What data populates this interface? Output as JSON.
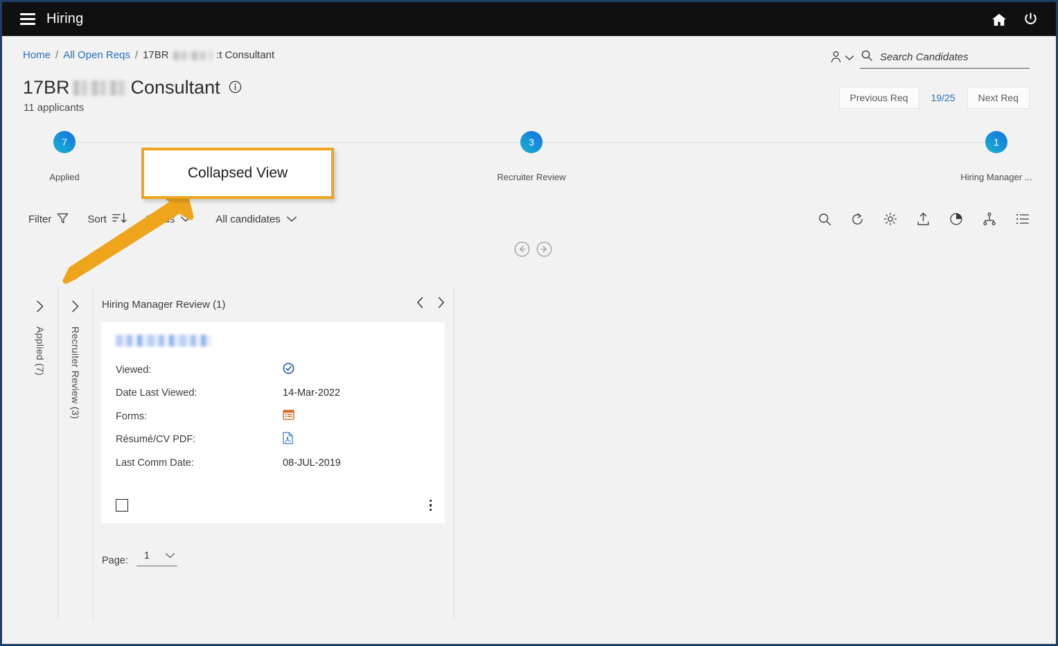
{
  "topbar": {
    "menu_icon": "hamburger-icon",
    "app_title": "Hiring",
    "home_icon": "home-icon",
    "power_icon": "power-icon"
  },
  "breadcrumb": {
    "items": [
      {
        "label": "Home",
        "link": true
      },
      {
        "label": "All Open Reqs",
        "link": true
      },
      {
        "label": "17BR",
        "link": false,
        "redacted_after": true,
        "suffix": ":t Consultant"
      }
    ],
    "separator": "/"
  },
  "header": {
    "title_prefix": "17BR",
    "title_suffix": "Consultant",
    "info_icon": "info-icon",
    "applicants": "11 applicants"
  },
  "search": {
    "person_icon": "person-icon",
    "chevron_icon": "chevron-down-icon",
    "search_icon": "search-icon",
    "placeholder": "Search Candidates",
    "value": ""
  },
  "req_pager": {
    "previous_label": "Previous Req",
    "count": "19/25",
    "next_label": "Next Req"
  },
  "pipeline": {
    "stages": [
      {
        "count": "7",
        "label": "Applied",
        "left_pct": 0
      },
      {
        "count": "3",
        "label": "Recruiter Review",
        "left_pct": 50
      },
      {
        "count": "1",
        "label": "Hiring Manager ...",
        "left_pct": 100
      }
    ]
  },
  "filterbar": {
    "filter_label": "Filter",
    "filter_icon": "funnel-icon",
    "sort_label": "Sort",
    "sort_icon": "sort-descending-icon",
    "status_label": "Status",
    "status_icon": "chevron-down-icon",
    "candidates_label": "All candidates",
    "candidates_icon": "chevron-down-icon"
  },
  "iconbar": {
    "icons": [
      "search-icon",
      "refresh-icon",
      "gear-icon",
      "upload-icon",
      "pie-chart-icon",
      "hierarchy-icon",
      "list-view-icon"
    ]
  },
  "center_nav": {
    "prev_icon": "circle-arrow-left-icon",
    "next_icon": "circle-arrow-right-icon"
  },
  "board": {
    "collapsed_columns": [
      {
        "label": "Applied (7)",
        "chevron_icon": "chevron-right-icon"
      },
      {
        "label": "Recruiter Review (3)",
        "chevron_icon": "chevron-right-icon"
      }
    ],
    "open_column": {
      "title": "Hiring Manager Review (1)",
      "prev_icon": "chevron-left-icon",
      "next_icon": "chevron-right-icon",
      "card": {
        "name_redacted": true,
        "rows": [
          {
            "label": "Viewed:",
            "value": "",
            "icon": "check-circle-icon"
          },
          {
            "label": "Date Last Viewed:",
            "value": "14-Mar-2022",
            "icon": ""
          },
          {
            "label": "Forms:",
            "value": "",
            "icon": "forms-icon"
          },
          {
            "label": "Résumé/CV PDF:",
            "value": "",
            "icon": "pdf-icon"
          },
          {
            "label": "Last Comm Date:",
            "value": "08-JUL-2019",
            "icon": ""
          }
        ],
        "checkbox_checked": false,
        "kebab_icon": "more-vertical-icon"
      },
      "pager": {
        "label": "Page:",
        "value": "1",
        "chevron_icon": "chevron-down-icon"
      }
    }
  },
  "annotation": {
    "callout_text": "Collapsed View",
    "accent_color": "#efa51b"
  },
  "colors": {
    "link": "#2a6ebb",
    "topbar_bg": "#101010",
    "page_bg": "#f2f2f2",
    "frame": "#1c3f66",
    "bubble_from": "#17b6c9",
    "bubble_to": "#1570e0"
  }
}
